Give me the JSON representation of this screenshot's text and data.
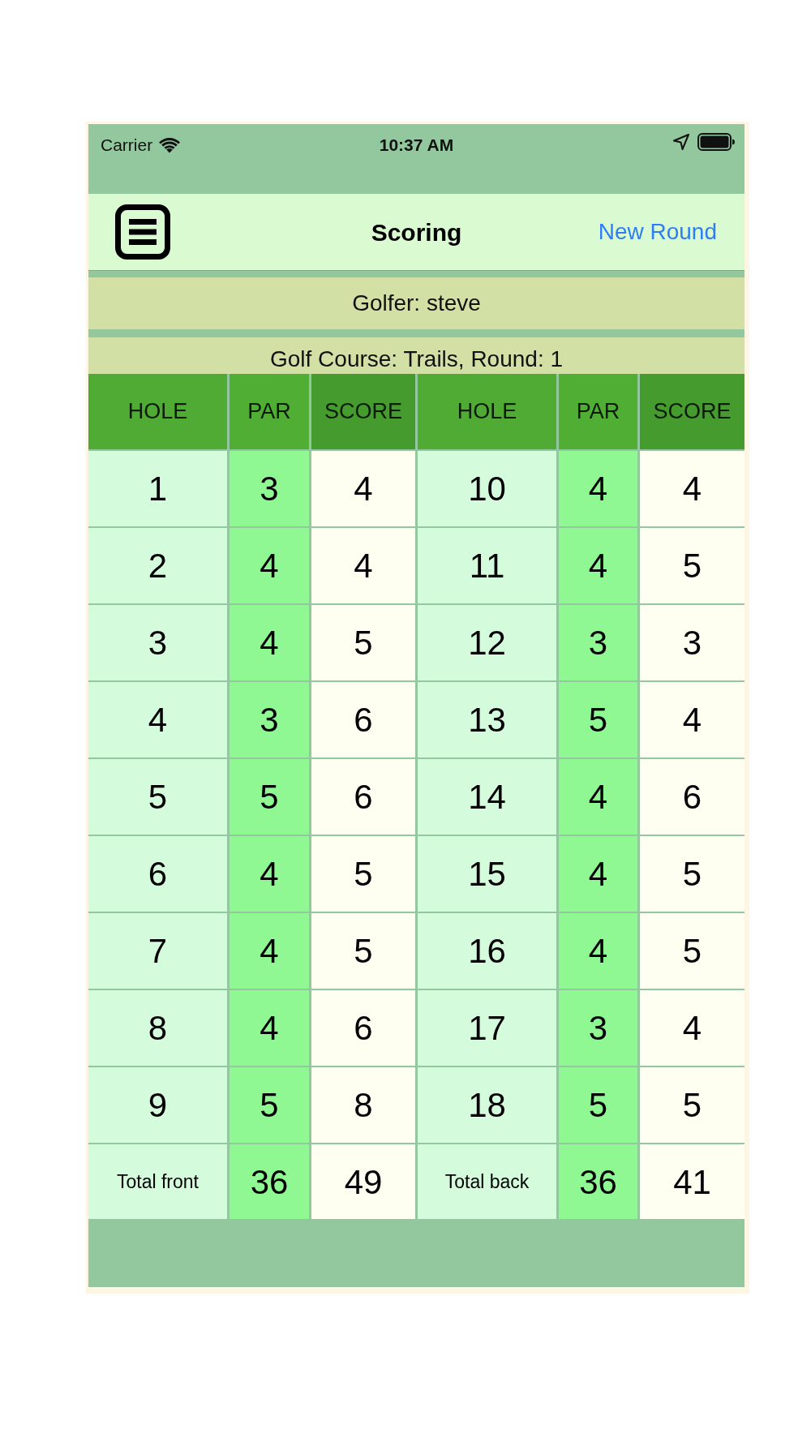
{
  "status_bar": {
    "carrier": "Carrier",
    "time": "10:37 AM"
  },
  "nav_bar": {
    "title": "Scoring",
    "action": "New Round"
  },
  "golfer_banner": "Golfer: steve",
  "course_banner": "Golf Course: Trails, Round: 1",
  "table": {
    "columns": [
      {
        "label": "HOLE",
        "kind": "hole"
      },
      {
        "label": "PAR",
        "kind": "par"
      },
      {
        "label": "SCORE",
        "kind": "score"
      },
      {
        "label": "HOLE",
        "kind": "hole"
      },
      {
        "label": "PAR",
        "kind": "par"
      },
      {
        "label": "SCORE",
        "kind": "score"
      }
    ],
    "rows": [
      [
        "1",
        "3",
        "4",
        "10",
        "4",
        "4"
      ],
      [
        "2",
        "4",
        "4",
        "11",
        "4",
        "5"
      ],
      [
        "3",
        "4",
        "5",
        "12",
        "3",
        "3"
      ],
      [
        "4",
        "3",
        "6",
        "13",
        "5",
        "4"
      ],
      [
        "5",
        "5",
        "6",
        "14",
        "4",
        "6"
      ],
      [
        "6",
        "4",
        "5",
        "15",
        "4",
        "5"
      ],
      [
        "7",
        "4",
        "5",
        "16",
        "4",
        "5"
      ],
      [
        "8",
        "4",
        "6",
        "17",
        "3",
        "4"
      ],
      [
        "9",
        "5",
        "8",
        "18",
        "5",
        "5"
      ]
    ],
    "totals": [
      "Total front",
      "36",
      "49",
      "Total back",
      "36",
      "41"
    ]
  }
}
